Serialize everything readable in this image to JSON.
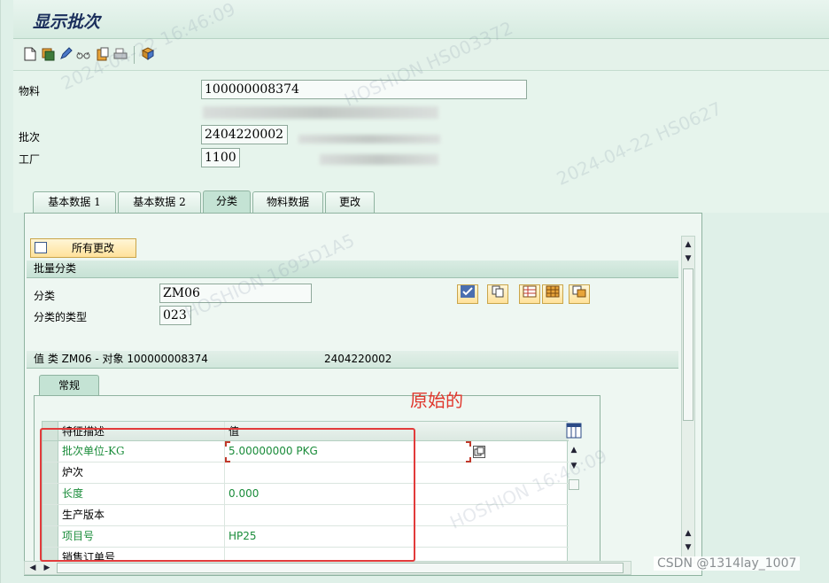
{
  "window": {
    "title": "显示批次"
  },
  "toolbar": {
    "icons": [
      "new-document-icon",
      "save-icon",
      "edit-pencil-icon",
      "glasses-display-icon",
      "clipboard-icon",
      "print-icon",
      "transport-icon"
    ]
  },
  "header": {
    "material_label": "物料",
    "material_value": "100000008374",
    "batch_label": "批次",
    "batch_value": "2404220002",
    "plant_label": "工厂",
    "plant_value": "1100"
  },
  "tabs": [
    {
      "label": "基本数据 1"
    },
    {
      "label": "基本数据 2"
    },
    {
      "label": "分类",
      "active": true
    },
    {
      "label": "物料数据"
    },
    {
      "label": "更改"
    }
  ],
  "classification": {
    "all_changes_label": "所有更改",
    "group_title": "批量分类",
    "class_label": "分类",
    "class_value": "ZM06",
    "class_type_label": "分类的类型",
    "class_type_value": "023",
    "values_prefix": "值 类",
    "values_class": "ZM06 -",
    "values_object_label": "对象",
    "values_object": "100000008374",
    "values_batch": "2404220002",
    "subtab_label": "常规"
  },
  "characteristics": {
    "columns": [
      "特征描述",
      "值"
    ],
    "rows": [
      {
        "desc": "批次单位-KG",
        "value": "5.00000000 PKG",
        "green": true
      },
      {
        "desc": "炉次",
        "value": "",
        "green": false
      },
      {
        "desc": "长度",
        "value": "0.000",
        "green": true
      },
      {
        "desc": "生产版本",
        "value": "",
        "green": false
      },
      {
        "desc": "项目号",
        "value": "HP25",
        "green": true
      },
      {
        "desc": "销售订单号",
        "value": "",
        "green": false
      }
    ]
  },
  "annotation": {
    "text": "原始的",
    "color": "#e0362c"
  },
  "footer": {
    "credit": "CSDN @1314lay_1007"
  },
  "colors": {
    "bg": "#dff0e8",
    "title": "#1b2f5c",
    "green_text": "#1a8c3a",
    "annotation": "#e23b3b"
  }
}
